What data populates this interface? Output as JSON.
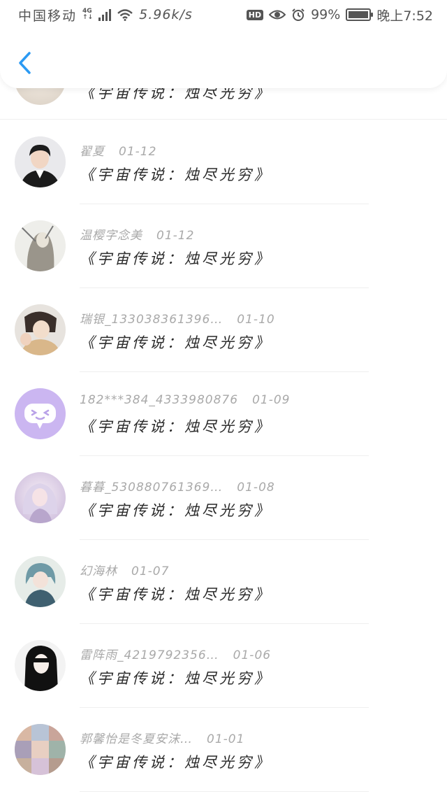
{
  "status_bar": {
    "carrier": "中国移动",
    "network": "4G",
    "speed": "5.96k/s",
    "hd": "HD",
    "battery": "99%",
    "time": "晚上7:52"
  },
  "header": {
    "back_icon": "chevron-left-icon",
    "accent_color": "#2b9af3"
  },
  "comments": [
    {
      "user": "",
      "date": "",
      "text": "《宇宙传说：烛尽光穷》",
      "avatar": "anime-avatar-partial"
    },
    {
      "user": "翟夏",
      "date": "01-12",
      "text": "《宇宙传说：烛尽光穷》",
      "avatar": "photo-avatar"
    },
    {
      "user": "温樱字念美",
      "date": "01-12",
      "text": "《宇宙传说：烛尽光穷》",
      "avatar": "ink-drawing-avatar"
    },
    {
      "user": "瑞银_133038361396…",
      "date": "01-10",
      "text": "《宇宙传说：烛尽光穷》",
      "avatar": "anime-avatar"
    },
    {
      "user": "182***384_4333980876",
      "date": "01-09",
      "text": "《宇宙传说：烛尽光穷》",
      "avatar": "chat-bubble-avatar"
    },
    {
      "user": "暮暮_530880761369…",
      "date": "01-08",
      "text": "《宇宙传说：烛尽光穷》",
      "avatar": "anime-avatar"
    },
    {
      "user": "幻海林",
      "date": "01-07",
      "text": "《宇宙传说：烛尽光穷》",
      "avatar": "anime-avatar"
    },
    {
      "user": "雷阵雨_4219792356…",
      "date": "01-06",
      "text": "《宇宙传说：烛尽光穷》",
      "avatar": "anime-avatar"
    },
    {
      "user": "郭馨怡是冬夏安沫…",
      "date": "01-01",
      "text": "《宇宙传说：烛尽光穷》",
      "avatar": "collage-avatar"
    }
  ]
}
